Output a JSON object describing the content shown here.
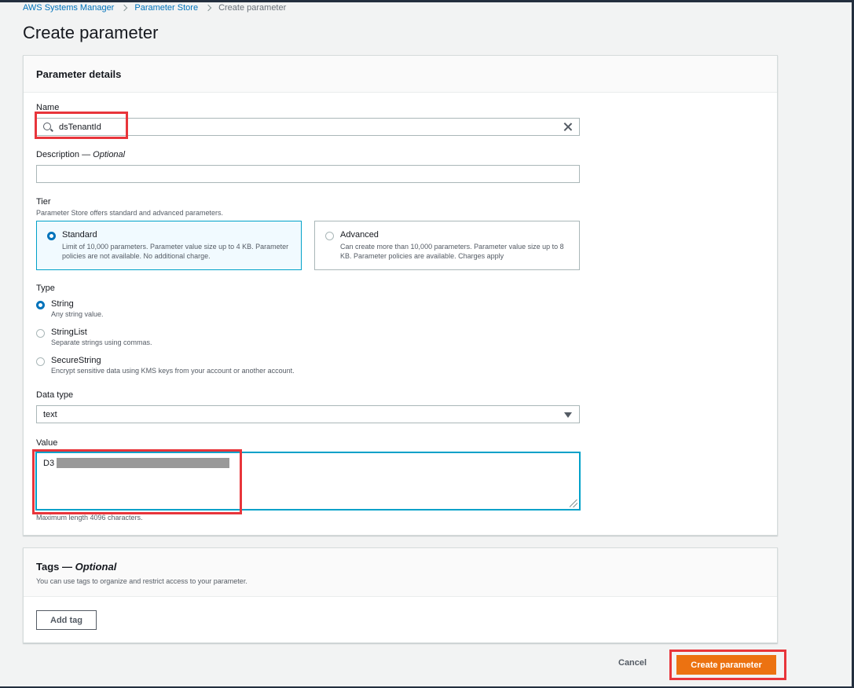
{
  "breadcrumb": {
    "items": [
      "AWS Systems Manager",
      "Parameter Store",
      "Create parameter"
    ]
  },
  "page_title": "Create parameter",
  "details": {
    "header": "Parameter details",
    "name": {
      "label": "Name",
      "value": "dsTenantId"
    },
    "description": {
      "label": "Description — ",
      "optional": "Optional",
      "value": ""
    },
    "tier": {
      "label": "Tier",
      "desc": "Parameter Store offers standard and advanced parameters.",
      "options": [
        {
          "title": "Standard",
          "desc": "Limit of 10,000 parameters. Parameter value size up to 4 KB. Parameter policies are not available. No additional charge.",
          "selected": true
        },
        {
          "title": "Advanced",
          "desc": "Can create more than 10,000 parameters. Parameter value size up to 8 KB. Parameter policies are available. Charges apply",
          "selected": false
        }
      ]
    },
    "type": {
      "label": "Type",
      "options": [
        {
          "title": "String",
          "desc": "Any string value.",
          "selected": true
        },
        {
          "title": "StringList",
          "desc": "Separate strings using commas.",
          "selected": false
        },
        {
          "title": "SecureString",
          "desc": "Encrypt sensitive data using KMS keys from your account or another account.",
          "selected": false
        }
      ]
    },
    "data_type": {
      "label": "Data type",
      "value": "text"
    },
    "value": {
      "label": "Value",
      "value": "D3",
      "hint": "Maximum length 4096 characters."
    }
  },
  "tags": {
    "title": "Tags — ",
    "optional": "Optional",
    "desc": "You can use tags to organize and restrict access to your parameter.",
    "add_label": "Add tag"
  },
  "actions": {
    "cancel": "Cancel",
    "create": "Create parameter"
  },
  "colors": {
    "primary": "#ec7211",
    "link": "#0073bb",
    "highlight": "#e8353b",
    "focus": "#00a1c9"
  }
}
